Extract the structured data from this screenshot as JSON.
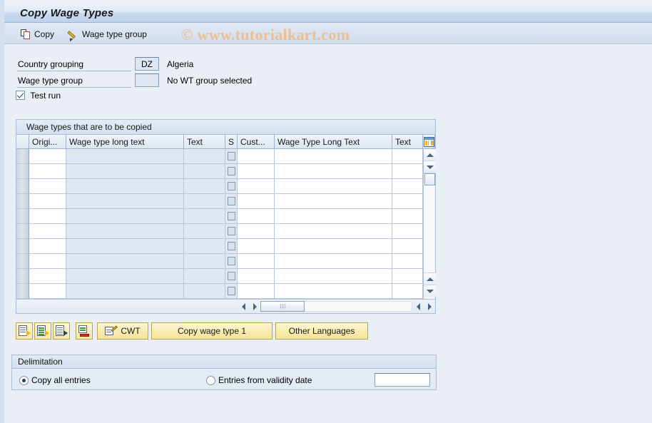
{
  "window": {
    "title": "Copy Wage Types"
  },
  "toolbar": {
    "copy_label": "Copy",
    "wage_type_group_label": "Wage type group"
  },
  "watermark": {
    "text": "© www.tutorialkart.com",
    "color": "#f0b97f"
  },
  "form": {
    "country_grouping": {
      "label": "Country grouping",
      "value": "DZ",
      "description": "Algeria"
    },
    "wage_type_group": {
      "label": "Wage type group",
      "value": "",
      "description": "No WT group selected"
    },
    "test_run": {
      "label": "Test run",
      "checked": true
    }
  },
  "table": {
    "caption": "Wage types that are to be copied",
    "columns": [
      {
        "key": "select",
        "label": "",
        "width": 18,
        "type": "selector"
      },
      {
        "key": "orig",
        "label": "Origi...",
        "width": 52,
        "type": "input"
      },
      {
        "key": "orig_txt",
        "label": "Wage type long text",
        "width": 165,
        "type": "readonly"
      },
      {
        "key": "text1",
        "label": "Text",
        "width": 58,
        "type": "readonly"
      },
      {
        "key": "s",
        "label": "S",
        "width": 17,
        "type": "checkbox"
      },
      {
        "key": "cust",
        "label": "Cust...",
        "width": 52,
        "type": "input"
      },
      {
        "key": "cust_txt",
        "label": "Wage Type Long Text",
        "width": 165,
        "type": "input"
      },
      {
        "key": "text2",
        "label": "Text",
        "width": 43,
        "type": "input"
      },
      {
        "key": "config",
        "label": "",
        "width": 17,
        "type": "config-icon"
      }
    ],
    "rows": [
      {
        "select": "",
        "orig": "",
        "orig_txt": "",
        "text1": "",
        "s": false,
        "cust": "",
        "cust_txt": "",
        "text2": ""
      },
      {
        "select": "",
        "orig": "",
        "orig_txt": "",
        "text1": "",
        "s": false,
        "cust": "",
        "cust_txt": "",
        "text2": ""
      },
      {
        "select": "",
        "orig": "",
        "orig_txt": "",
        "text1": "",
        "s": false,
        "cust": "",
        "cust_txt": "",
        "text2": ""
      },
      {
        "select": "",
        "orig": "",
        "orig_txt": "",
        "text1": "",
        "s": false,
        "cust": "",
        "cust_txt": "",
        "text2": ""
      },
      {
        "select": "",
        "orig": "",
        "orig_txt": "",
        "text1": "",
        "s": false,
        "cust": "",
        "cust_txt": "",
        "text2": ""
      },
      {
        "select": "",
        "orig": "",
        "orig_txt": "",
        "text1": "",
        "s": false,
        "cust": "",
        "cust_txt": "",
        "text2": ""
      },
      {
        "select": "",
        "orig": "",
        "orig_txt": "",
        "text1": "",
        "s": false,
        "cust": "",
        "cust_txt": "",
        "text2": ""
      },
      {
        "select": "",
        "orig": "",
        "orig_txt": "",
        "text1": "",
        "s": false,
        "cust": "",
        "cust_txt": "",
        "text2": ""
      },
      {
        "select": "",
        "orig": "",
        "orig_txt": "",
        "text1": "",
        "s": false,
        "cust": "",
        "cust_txt": "",
        "text2": ""
      },
      {
        "select": "",
        "orig": "",
        "orig_txt": "",
        "text1": "",
        "s": false,
        "cust": "",
        "cust_txt": "",
        "text2": ""
      }
    ]
  },
  "button_bar": {
    "icon_buttons": [
      {
        "name": "insert-line-button",
        "glyph": "doc-yellow-arrow"
      },
      {
        "name": "copy-line-button",
        "glyph": "doc-green-arrow"
      },
      {
        "name": "paste-line-button",
        "glyph": "doc-plain-arrow"
      },
      {
        "name": "delete-line-button",
        "glyph": "doc-red-bar"
      }
    ],
    "buttons": [
      {
        "name": "cwt-button",
        "label": "CWT"
      },
      {
        "name": "copy-wage-type-1-button",
        "label": "Copy wage type 1"
      },
      {
        "name": "other-languages-button",
        "label": "Other Languages"
      }
    ]
  },
  "delimitation": {
    "title": "Delimitation",
    "copy_all_entries": {
      "label": "Copy all entries",
      "selected": true
    },
    "entries_from_validity_date": {
      "label": "Entries from validity date",
      "selected": false
    },
    "validity_date_value": ""
  }
}
